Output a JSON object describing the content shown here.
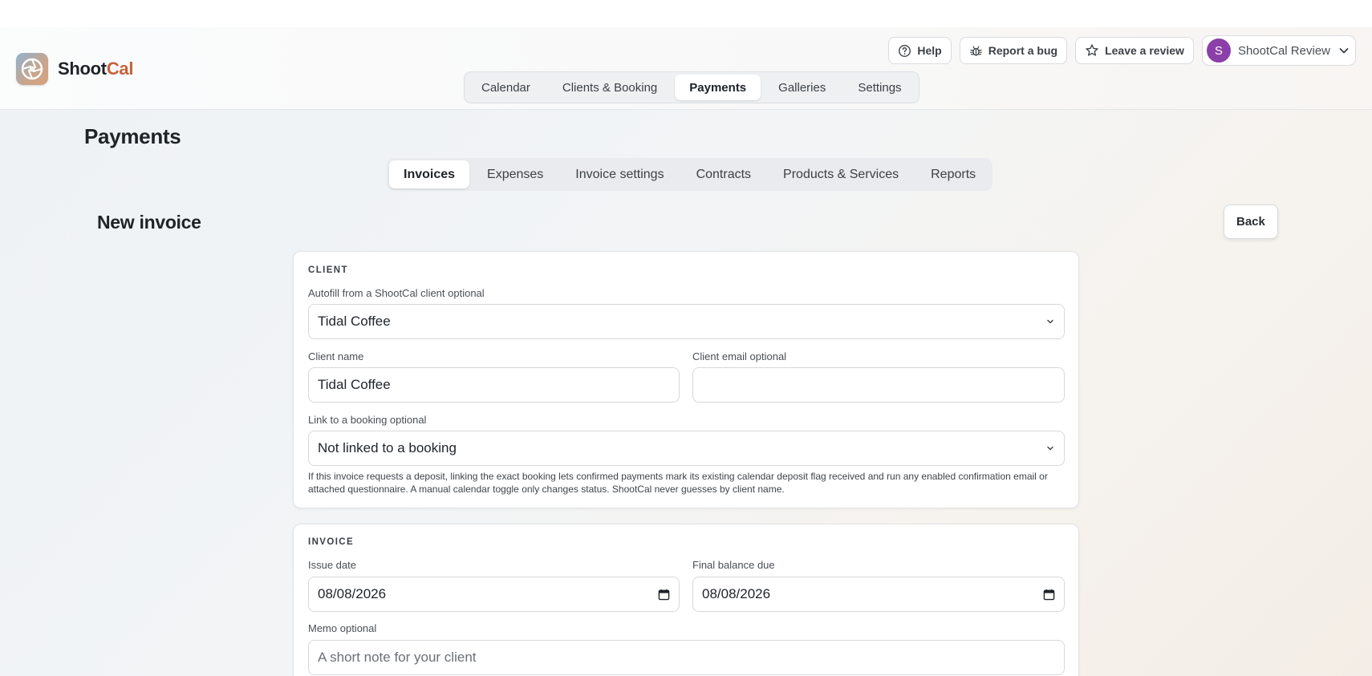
{
  "brand": {
    "name_part1": "Shoot",
    "name_part2": "Cal",
    "accent": "#c5633a"
  },
  "top_actions": {
    "help": "Help",
    "report_bug": "Report a bug",
    "leave_review": "Leave a review",
    "account_initial": "S",
    "account_name": "ShootCal Review"
  },
  "main_nav": {
    "tabs": [
      {
        "label": "Calendar"
      },
      {
        "label": "Clients & Booking"
      },
      {
        "label": "Payments"
      },
      {
        "label": "Galleries"
      },
      {
        "label": "Settings"
      }
    ],
    "active": "Payments"
  },
  "page_title": "Payments",
  "sub_nav": {
    "tabs": [
      {
        "label": "Invoices"
      },
      {
        "label": "Expenses"
      },
      {
        "label": "Invoice settings"
      },
      {
        "label": "Contracts"
      },
      {
        "label": "Products & Services"
      },
      {
        "label": "Reports"
      }
    ],
    "active": "Invoices"
  },
  "section_title": "New invoice",
  "back_label": "Back",
  "client_card": {
    "eyebrow": "CLIENT",
    "autofill_label": "Autofill from a ShootCal client optional",
    "autofill_value": "Tidal Coffee",
    "client_name_label": "Client name",
    "client_name_value": "Tidal Coffee",
    "client_email_label": "Client email optional",
    "client_email_value": "",
    "booking_label": "Link to a booking optional",
    "booking_value": "Not linked to a booking",
    "help_text": "If this invoice requests a deposit, linking the exact booking lets confirmed payments mark its existing calendar deposit flag received and run any enabled confirmation email or attached questionnaire. A manual calendar toggle only changes status. ShootCal never guesses by client name."
  },
  "invoice_card": {
    "eyebrow": "INVOICE",
    "issue_date_label": "Issue date",
    "issue_date_value": "08/08/2026",
    "final_due_label": "Final balance due",
    "final_due_value": "08/08/2026",
    "memo_label": "Memo optional",
    "memo_placeholder": "A short note for your client"
  }
}
